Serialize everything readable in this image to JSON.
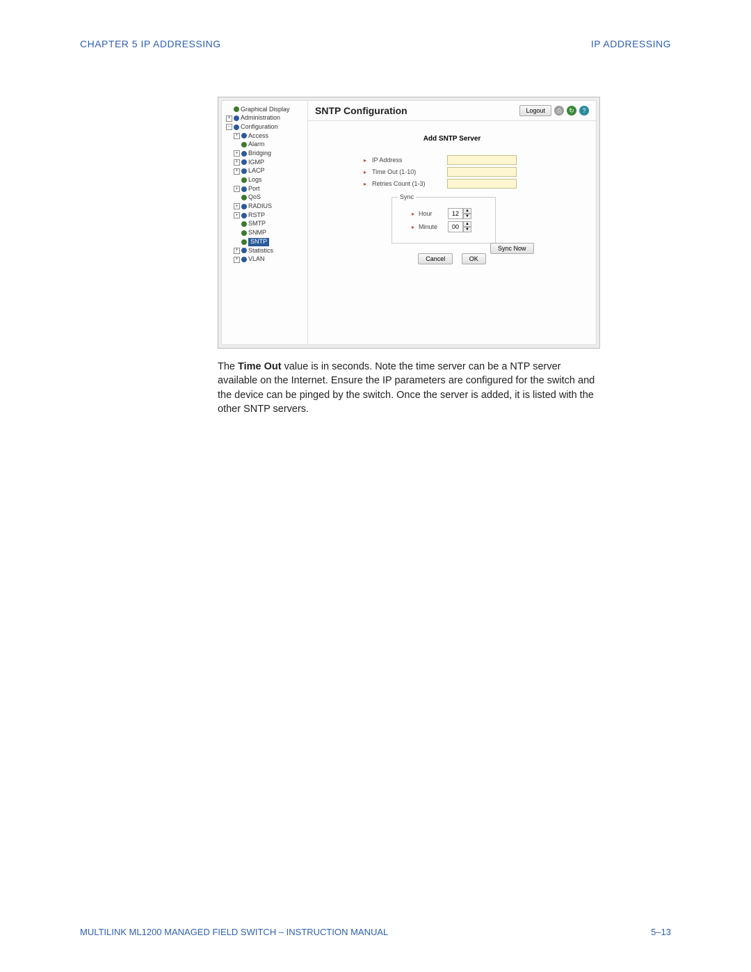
{
  "header": {
    "left": "CHAPTER 5  IP ADDRESSING",
    "right": "IP ADDRESSING"
  },
  "tree": {
    "graphical": "Graphical Display",
    "admin": "Administration",
    "config": "Configuration",
    "items": {
      "access": "Access",
      "alarm": "Alarm",
      "bridging": "Bridging",
      "igmp": "IGMP",
      "lacp": "LACP",
      "logs": "Logs",
      "port": "Port",
      "qos": "QoS",
      "radius": "RADIUS",
      "rstp": "RSTP",
      "smtp": "SMTP",
      "snmp": "SNMP",
      "sntp": "SNTP",
      "statistics": "Statistics",
      "vlan": "VLAN"
    }
  },
  "main": {
    "title": "SNTP Configuration",
    "logout": "Logout",
    "form_title": "Add SNTP Server",
    "ip_label": "IP Address",
    "timeout_label": "Time Out (1-10)",
    "retries_label": "Retries Count (1-3)",
    "sync_legend": "Sync",
    "hour_label": "Hour",
    "minute_label": "Minute",
    "hour_value": "12",
    "minute_value": "00",
    "sync_now": "Sync Now",
    "cancel": "Cancel",
    "ok": "OK"
  },
  "body": {
    "p1a": "The ",
    "p1b": "Time Out",
    "p1c": " value is in seconds. Note the time server can be a NTP server available on the Internet. Ensure the IP parameters are configured for the switch and the device can be pinged by the switch. Once the server is added, it is listed with the other SNTP servers."
  },
  "footer": {
    "left": "MULTILINK ML1200 MANAGED FIELD SWITCH – INSTRUCTION MANUAL",
    "right": "5–13"
  }
}
